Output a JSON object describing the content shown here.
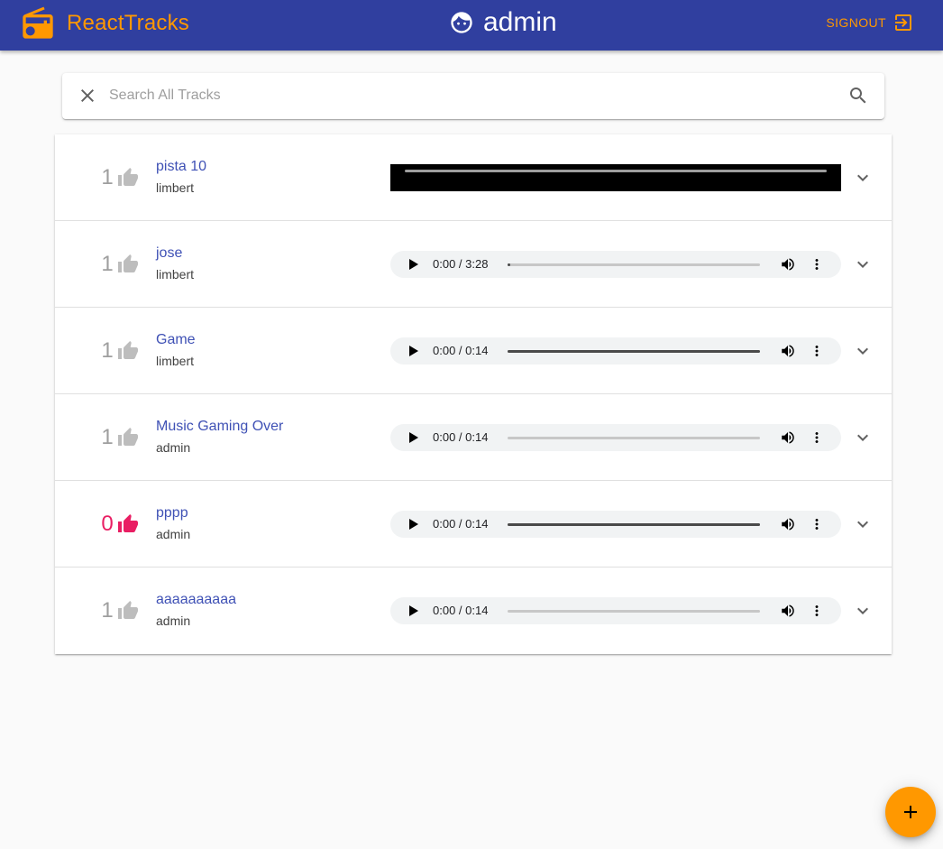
{
  "header": {
    "app_name": "ReactTracks",
    "username": "admin",
    "signout_label": "SIGNOUT"
  },
  "search": {
    "placeholder": "Search All Tracks",
    "value": ""
  },
  "tracks": [
    {
      "title": "pista 10",
      "artist": "limbert",
      "likes": "1",
      "liked": false,
      "player": "video",
      "time": "",
      "progress": 0
    },
    {
      "title": "jose",
      "artist": "limbert",
      "likes": "1",
      "liked": false,
      "player": "audio",
      "time": "0:00 / 3:28",
      "progress": 0.01
    },
    {
      "title": "Game",
      "artist": "limbert",
      "likes": "1",
      "liked": false,
      "player": "audio",
      "time": "0:00 / 0:14",
      "progress": 1
    },
    {
      "title": "Music Gaming Over",
      "artist": "admin",
      "likes": "1",
      "liked": false,
      "player": "audio",
      "time": "0:00 / 0:14",
      "progress": 0
    },
    {
      "title": "pppp",
      "artist": "admin",
      "likes": "0",
      "liked": true,
      "player": "audio",
      "time": "0:00 / 0:14",
      "progress": 1
    },
    {
      "title": "aaaaaaaaaa",
      "artist": "admin",
      "likes": "1",
      "liked": false,
      "player": "audio",
      "time": "0:00 / 0:14",
      "progress": 0
    }
  ],
  "colors": {
    "appbar": "#303f9f",
    "accent": "#ff9800",
    "title": "#3f51b5",
    "liked": "#e91e63",
    "unliked": "#9e9e9e"
  },
  "icons": {
    "logo": "radio-icon",
    "user": "face-icon",
    "signout": "exit-to-app-icon",
    "clear": "close-icon",
    "search": "search-icon",
    "like": "thumb-up-icon",
    "expand": "chevron-down-icon",
    "add": "add-icon"
  }
}
